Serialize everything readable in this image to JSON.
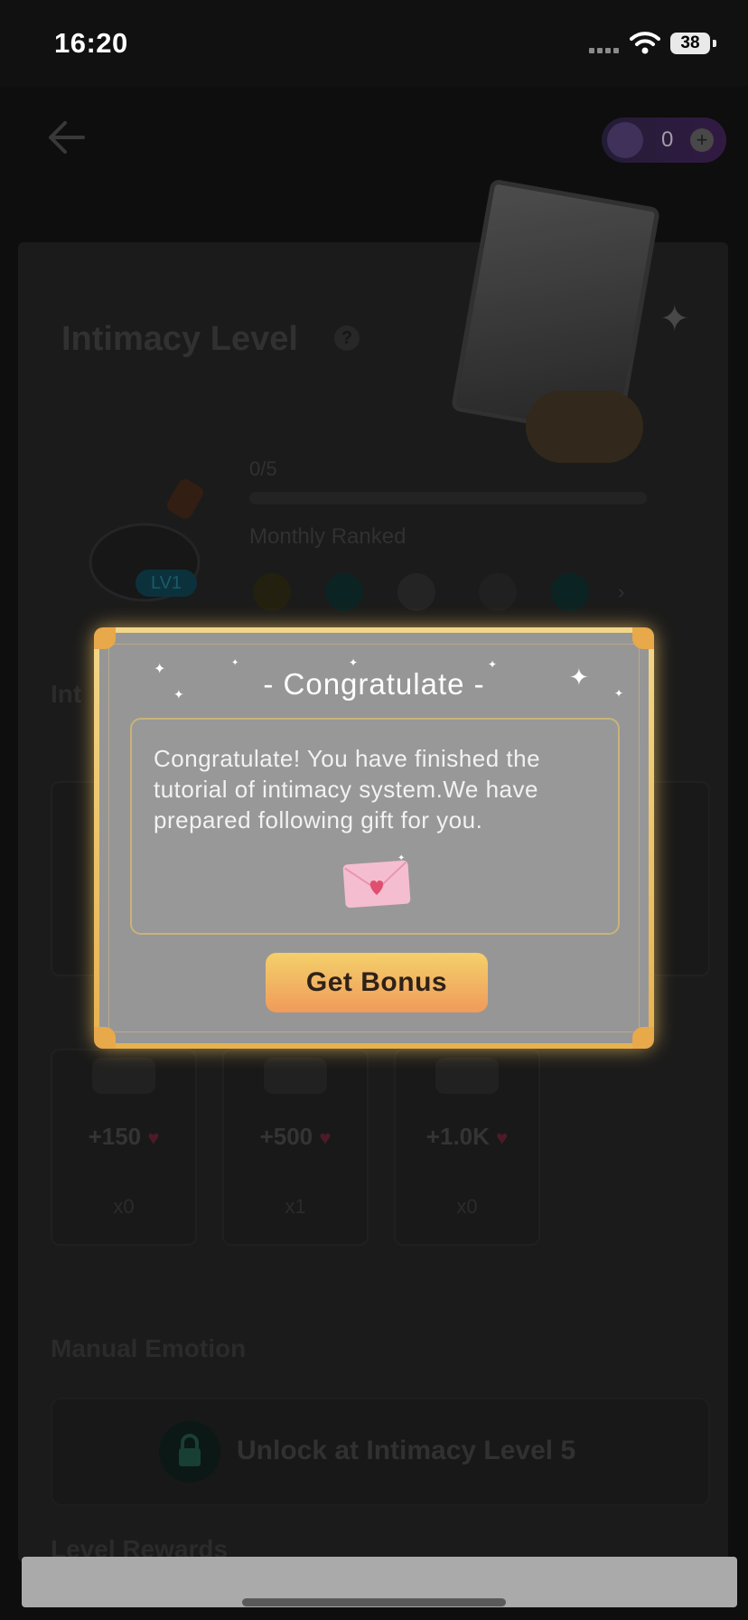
{
  "status_bar": {
    "time": "16:20",
    "battery": "38"
  },
  "header": {
    "coin_value": "0",
    "coin_plus": "+"
  },
  "intimacy": {
    "title": "Intimacy Level",
    "help": "?",
    "level_badge": "LV1",
    "progress_text": "0/5",
    "progress_fraction": 0,
    "monthly_ranked_label": "Monthly Ranked",
    "section_label_partial": "Int"
  },
  "gifts": [
    {
      "value": "+150",
      "count": "x0"
    },
    {
      "value": "+500",
      "count": "x1"
    },
    {
      "value": "+1.0K",
      "count": "x0"
    }
  ],
  "manual_emotion": {
    "label": "Manual Emotion",
    "unlock_text": "Unlock at Intimacy Level 5"
  },
  "level_rewards": {
    "label": "Level Rewards"
  },
  "modal": {
    "title": "- Congratulate -",
    "message": "Congratulate! You have finished the tutorial of intimacy system.We have prepared following gift for you.",
    "button": "Get Bonus"
  },
  "colors": {
    "modal_frame": "#e8b24f",
    "modal_bg": "#969696",
    "button_top": "#f4d06a",
    "button_bottom": "#ef9b5b",
    "heart": "#e86a8a"
  },
  "icons": [
    "back-arrow-icon",
    "diamond-icon",
    "plus-icon",
    "help-icon",
    "lock-icon",
    "heart-icon",
    "envelope-icon",
    "chevron-right-icon",
    "wifi-icon",
    "battery-icon"
  ]
}
